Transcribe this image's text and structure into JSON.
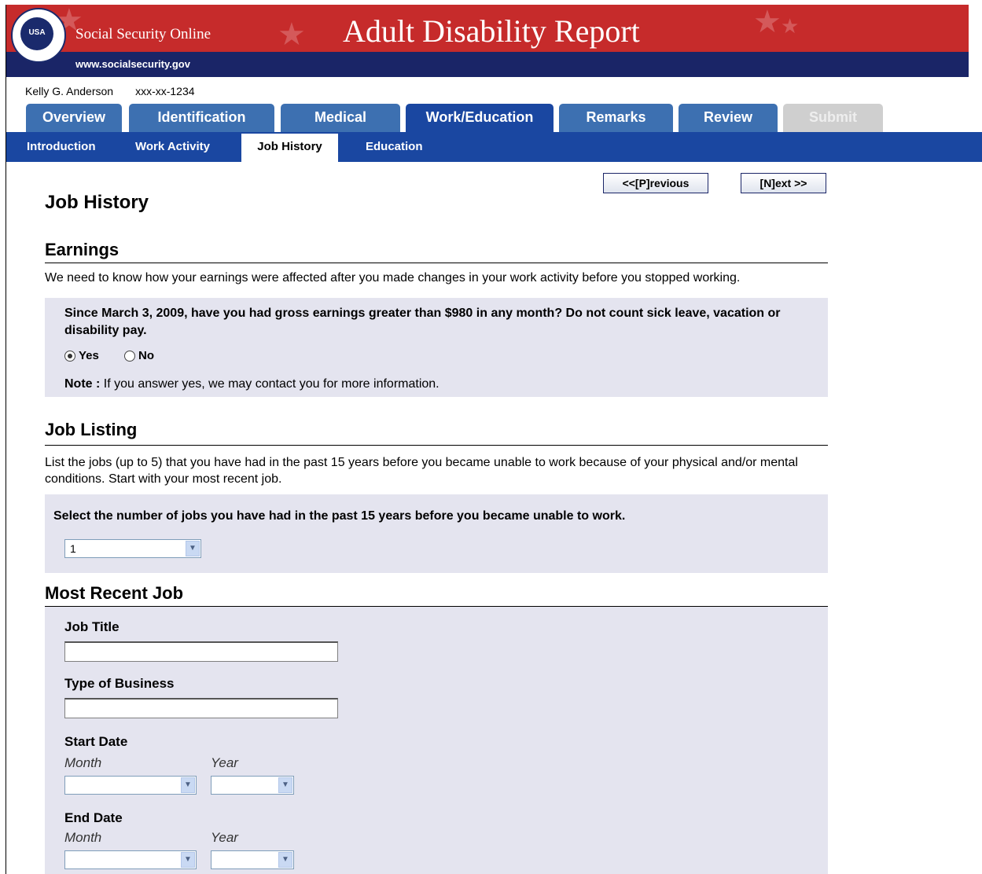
{
  "header": {
    "brand": "Social Security Online",
    "title": "Adult Disability Report",
    "url": "www.socialsecurity.gov",
    "seal_text": "USA"
  },
  "user": {
    "name": "Kelly G. Anderson",
    "ssn": "xxx-xx-1234"
  },
  "tabs": [
    "Overview",
    "Identification",
    "Medical",
    "Work/Education",
    "Remarks",
    "Review",
    "Submit"
  ],
  "subnav": [
    "Introduction",
    "Work Activity",
    "Job History",
    "Education"
  ],
  "nav": {
    "previous": "<<[P]revious",
    "next": "[N]ext >>"
  },
  "page_title": "Job History",
  "earnings": {
    "heading": "Earnings",
    "intro": "We need to know how your earnings were affected after you made changes in your work activity before you stopped working.",
    "question": "Since March 3, 2009, have you had gross earnings greater than  $980 in any month?  Do not count sick leave, vacation or disability pay.",
    "yes": "Yes",
    "no": "No",
    "selected": "Yes",
    "note_label": "Note :",
    "note_text": " If you answer yes, we may contact you for more information."
  },
  "job_listing": {
    "heading": "Job Listing",
    "intro": "List the jobs (up to 5) that you have had in the past 15 years before you became unable to work because of your physical and/or mental conditions. Start with your most recent job.",
    "question": "Select the number of jobs you have had in the past 15 years before you became unable to work.",
    "selected_count": "1"
  },
  "recent_job": {
    "heading": "Most Recent Job",
    "job_title_label": "Job Title",
    "job_title_value": "",
    "business_label": "Type of Business",
    "business_value": "",
    "start_label": "Start Date",
    "end_label": "End Date",
    "month_label": "Month",
    "year_label": "Year"
  },
  "colors": {
    "banner_red": "#c62b2b",
    "navy": "#1a2567",
    "tab_blue": "#3d70b1",
    "active_blue": "#1a47a1",
    "panel": "#e4e4ef"
  }
}
